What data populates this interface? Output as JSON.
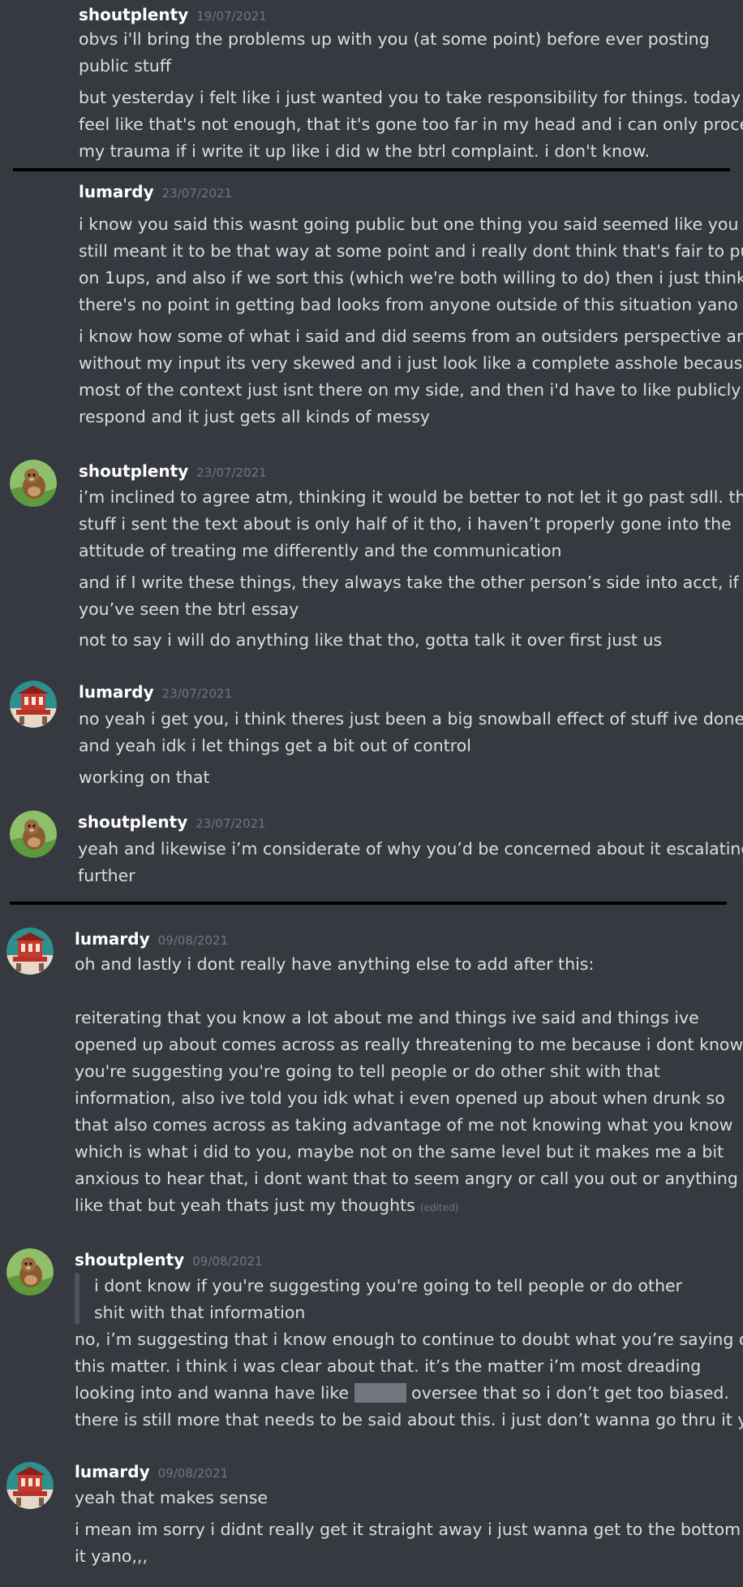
{
  "colors": {
    "background": "#36393f",
    "text": "#dcddde",
    "username": "#ffffff",
    "timestamp": "#72767d",
    "divider": "#000000",
    "quote_bar": "#4f545c",
    "redaction": "#72767d"
  },
  "messages": [
    {
      "author": "shoutplenty",
      "timestamp": "19/07/2021",
      "lines": [
        "obvs i'll bring the problems up with you (at some point) before ever posting",
        "public stuff",
        "but yesterday i felt like i just wanted you to take responsibility for things. today i",
        "feel like that's not enough, that it's gone too far in my head and i can only process",
        "my trauma if i write it up like i did w the btrl complaint. i don't know."
      ]
    },
    {
      "author": "lumardy",
      "timestamp": "23/07/2021",
      "lines": [
        "i know you said this wasnt going public but one thing you said seemed like you",
        "still meant it to be that way at some point and i really dont think that's fair to put",
        "on 1ups, and also if we sort this (which we're both willing to do) then i just think",
        "there's no point in getting bad looks from anyone outside of this situation yano",
        "i know how some of what i said and did seems from an outsiders perspective and",
        "without my input its very skewed and i just look like a complete asshole because",
        "most of the context just isnt there on my side, and then i'd have to like publicly",
        "respond and it just gets all kinds of messy"
      ]
    },
    {
      "author": "shoutplenty",
      "timestamp": "23/07/2021",
      "avatar": "otter-plush-avatar",
      "lines": [
        "i’m inclined to agree atm, thinking it would be better to not let it go past sdll. that",
        "stuff i sent the text about is only half of it tho, i haven’t properly gone into the",
        "attitude of treating me differently and the communication",
        "and if I write these things, they always take the other person’s side into acct, if",
        "you’ve seen the btrl essay",
        "not to say i will do anything like that tho, gotta talk it over first just us"
      ]
    },
    {
      "author": "lumardy",
      "timestamp": "23/07/2021",
      "avatar": "temple-avatar",
      "lines": [
        "no yeah i get you, i think theres just been a big snowball effect of stuff ive done",
        "and yeah idk i let things get a bit out of control",
        "working on that"
      ]
    },
    {
      "author": "shoutplenty",
      "timestamp": "23/07/2021",
      "avatar": "otter-plush-avatar",
      "lines": [
        "yeah and likewise i’m considerate of why you’d be concerned about it escalating",
        "further"
      ]
    },
    {
      "author": "lumardy",
      "timestamp": "09/08/2021",
      "avatar": "temple-avatar",
      "lines": [
        "oh and lastly i dont really have anything else to add after this:",
        "reiterating that you know a lot about me and things ive said and things ive",
        "opened up about comes across as really threatening to me because i dont know if",
        "you're suggesting you're going to tell people or do other shit with that",
        "information, also ive told you idk what i even opened up about when drunk so",
        "that also comes across as taking advantage of me not knowing what you know",
        "which is what i did to you, maybe not on the same level but it makes me a bit",
        "anxious to hear that, i dont want that to seem angry or call you out or anything",
        "like that but yeah thats just my thoughts"
      ],
      "edited": "(edited)"
    },
    {
      "author": "shoutplenty",
      "timestamp": "09/08/2021",
      "avatar": "otter-plush-avatar",
      "quote": [
        "i dont know if you're suggesting you're going to tell people or do other",
        "shit with that information"
      ],
      "lines": [
        "no, i’m suggesting that i know enough to continue to doubt what you’re saying on",
        "this matter. i think i was clear about that. it’s the matter i’m most dreading",
        "looking into and wanna have like",
        "oversee that so i don’t get too biased.",
        "there is still more that needs to be said about this. i just don’t wanna go thru it yet"
      ]
    },
    {
      "author": "lumardy",
      "timestamp": "09/08/2021",
      "avatar": "temple-avatar",
      "lines": [
        "yeah that makes sense",
        "i mean im sorry i didnt really get it straight away i just wanna get to the bottom of",
        "it yano,,,"
      ]
    }
  ]
}
